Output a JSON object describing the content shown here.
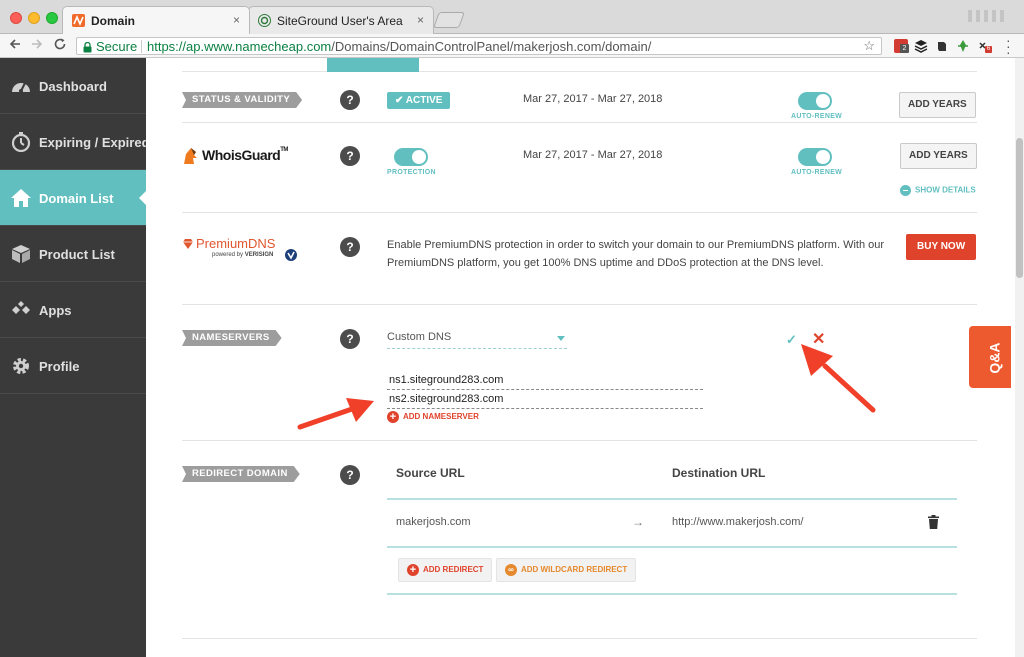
{
  "browser": {
    "tabs": [
      {
        "title": "Domain",
        "favicon_color": "#f06a2a"
      },
      {
        "title": "SiteGround User's Area",
        "favicon_color": "#2f7a3b"
      }
    ],
    "secure_label": "Secure",
    "url_host": "https://ap.www.namecheap.com",
    "url_path": "/Domains/DomainControlPanel/makerjosh.com/domain/",
    "close_glyph": "×",
    "extension_badges": {
      "calendar": "2",
      "lastpass": "6"
    }
  },
  "sidebar": {
    "items": [
      {
        "label": "Dashboard",
        "icon": "speedometer-icon"
      },
      {
        "label": "Expiring / Expired",
        "icon": "stopwatch-icon"
      },
      {
        "label": "Domain List",
        "icon": "home-icon",
        "active": true
      },
      {
        "label": "Product List",
        "icon": "box-icon"
      },
      {
        "label": "Apps",
        "icon": "apps-diamonds-icon"
      },
      {
        "label": "Profile",
        "icon": "gear-icon"
      }
    ]
  },
  "main": {
    "status": {
      "label": "STATUS & VALIDITY",
      "badge": "✔ ACTIVE",
      "dates": "Mar 27, 2017 - Mar 27, 2018",
      "auto_renew_label": "AUTO-RENEW",
      "auto_renew_on": true,
      "button": "ADD YEARS"
    },
    "whoisguard": {
      "logo_text": "WhoisGuard",
      "logo_tm": "TM",
      "protection_label": "PROTECTION",
      "protection_on": true,
      "dates": "Mar 27, 2017 - Mar 27, 2018",
      "auto_renew_label": "AUTO-RENEW",
      "auto_renew_on": true,
      "button": "ADD YEARS",
      "show_details": "SHOW DETAILS"
    },
    "premiumdns": {
      "logo_text": "PremiumDNS",
      "powered_by": "powered by",
      "verisign": "VERISIGN",
      "description": "Enable PremiumDNS protection in order to switch your domain to our PremiumDNS platform. With our PremiumDNS platform, you get 100% DNS uptime and DDoS protection at the DNS level.",
      "button": "BUY NOW"
    },
    "nameservers": {
      "label": "NAMESERVERS",
      "selected": "Custom DNS",
      "confirm_glyph": "✓",
      "cancel_glyph": "✕",
      "entries": [
        "ns1.siteground283.com",
        "ns2.siteground283.com"
      ],
      "add_label": "ADD NAMESERVER"
    },
    "redirect": {
      "label": "REDIRECT DOMAIN",
      "columns": [
        "Source URL",
        "Destination URL"
      ],
      "rows": [
        {
          "source": "makerjosh.com",
          "arrow": "→",
          "destination": "http://www.makerjosh.com/"
        }
      ],
      "add_redirect": "ADD REDIRECT",
      "add_wildcard": "ADD WILDCARD REDIRECT"
    },
    "help_glyph": "?"
  },
  "qa_tab": {
    "label": "Q&A"
  },
  "colors": {
    "teal": "#62bfc0",
    "sidebar_bg": "#3a3a3a",
    "buy_red": "#e0432c",
    "annotation_red": "#f0402a"
  }
}
